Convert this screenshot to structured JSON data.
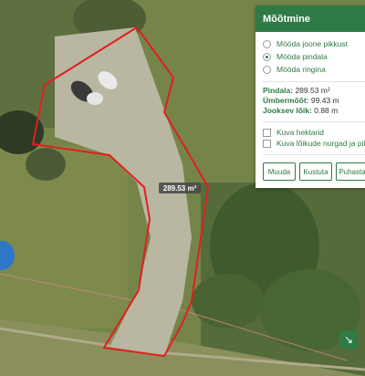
{
  "panel": {
    "title": "Mõõtmine",
    "modes": [
      {
        "label": "Mööda joone pikkust",
        "selected": false
      },
      {
        "label": "Mööda pindala",
        "selected": true
      },
      {
        "label": "Mööda ringina",
        "selected": false
      }
    ],
    "stats": {
      "area_label": "Pindala:",
      "area_value": "289.53 m²",
      "perimeter_label": "Ümbermõõt:",
      "perimeter_value": "99.43 m",
      "segment_label": "Jooksev lõik:",
      "segment_value": "0.88 m"
    },
    "options": [
      {
        "label": "Kuva hektarid",
        "checked": false
      },
      {
        "label": "Kuva lõikude nurgad ja pikkused",
        "checked": false
      }
    ],
    "buttons": {
      "edit": "Muuda",
      "delete": "Kustuta",
      "clear": "Puhasta"
    }
  },
  "map": {
    "area_label": "289.53 m²",
    "polygon_color": "#e02020",
    "accent_color": "#2f7a45"
  }
}
